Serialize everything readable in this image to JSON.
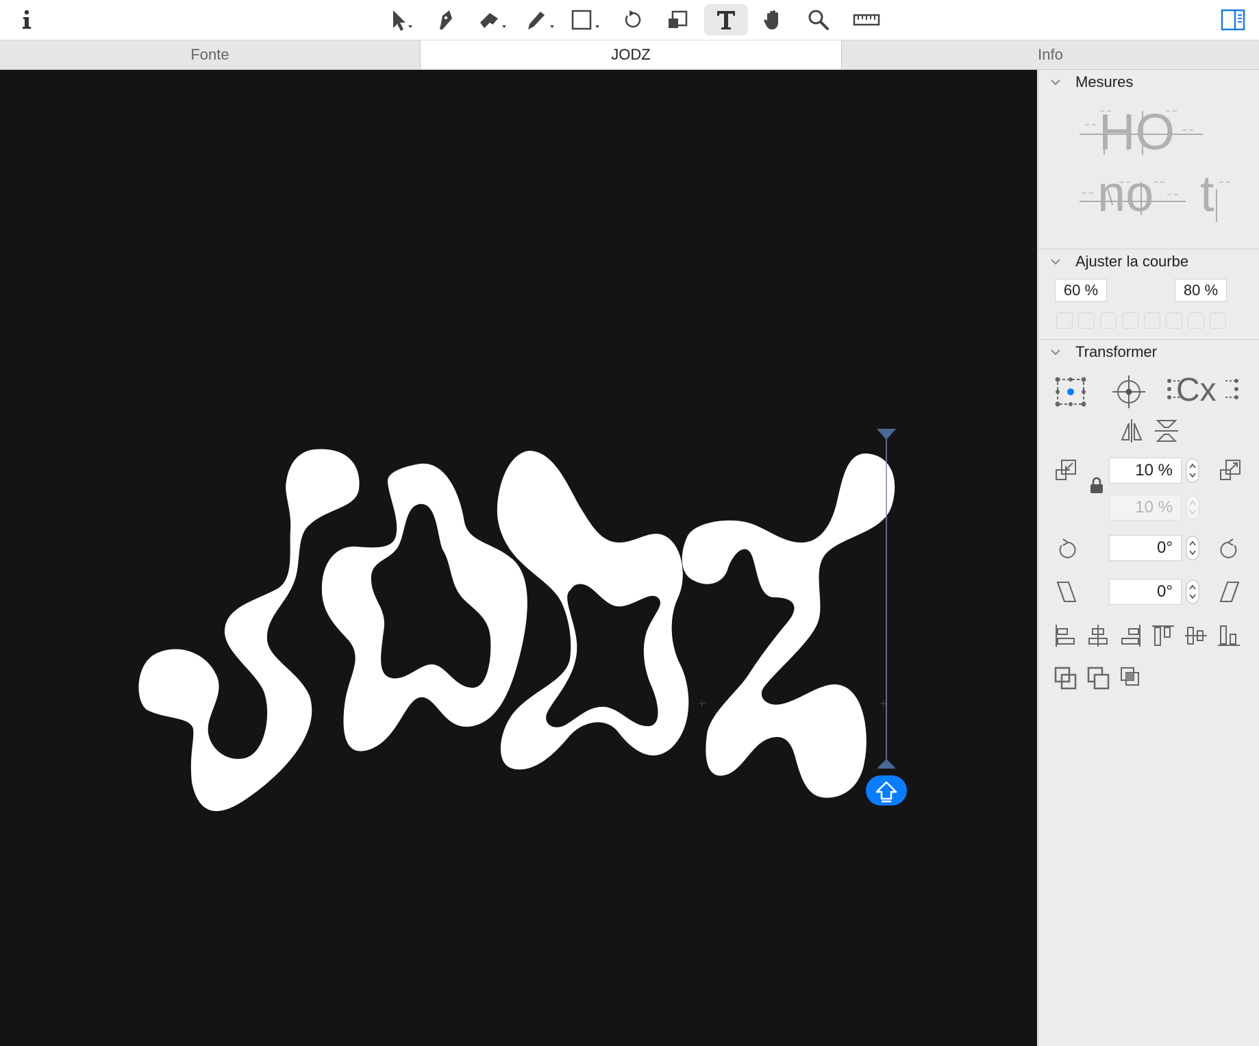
{
  "toolbar": {
    "info_icon": "info-icon",
    "tools": [
      "select-tool-icon",
      "pen-tool-icon",
      "eraser-tool-icon",
      "pencil-tool-icon",
      "rectangle-tool-icon",
      "rotate-tool-icon",
      "scale-tool-icon",
      "text-tool-icon",
      "hand-tool-icon",
      "zoom-tool-icon",
      "measure-tool-icon"
    ],
    "active_tool": "text-tool-icon",
    "sidebar_toggle_icon": "sidebar-toggle-icon"
  },
  "tabs": [
    {
      "label": "Fonte",
      "active": false
    },
    {
      "label": "JODZ",
      "active": true
    },
    {
      "label": "Info",
      "active": false
    }
  ],
  "canvas": {
    "background": "#141414",
    "glyph_color": "#ffffff",
    "accent": "#0a7cff",
    "glyphs": [
      "J",
      "O",
      "D",
      "Z"
    ]
  },
  "panel": {
    "mesures": {
      "title": "Mesures",
      "preview_top": "HO",
      "preview_bottom_left": "no",
      "preview_bottom_right": "t"
    },
    "ajuster": {
      "title": "Ajuster la courbe",
      "value_left": "60 %",
      "value_right": "80 %"
    },
    "transformer": {
      "title": "Transformer",
      "cx_label": "Cx",
      "scale_x": "10 %",
      "scale_y": "10 %",
      "rotate": "0°",
      "slant": "0°"
    }
  }
}
